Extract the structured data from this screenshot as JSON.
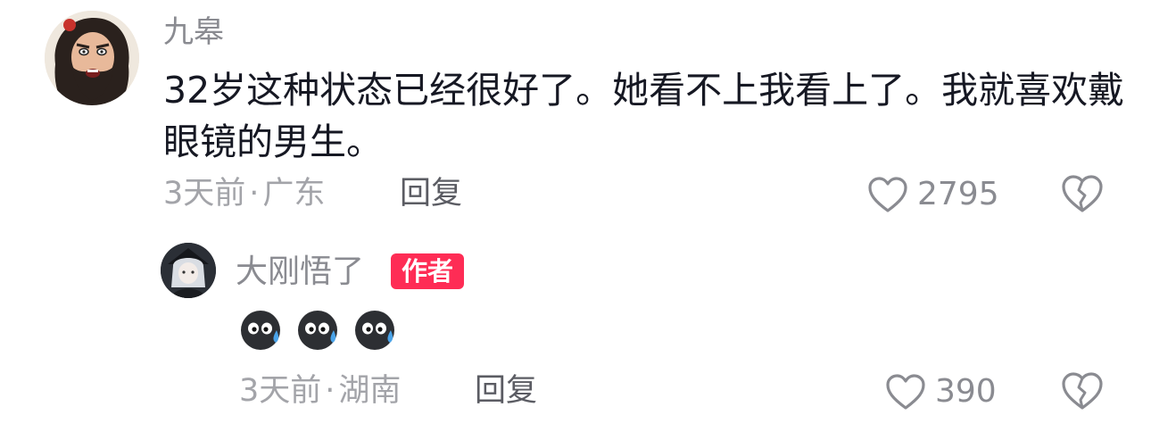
{
  "comment": {
    "username": "九皋",
    "avatar_icon": "bearded-man-avatar",
    "text": "32岁这种状态已经很好了。她看不上我看上了。我就喜欢戴眼镜的男生。",
    "time": "3天前",
    "location": "广东",
    "separator": "·",
    "reply_label": "回复",
    "like_count": "2795",
    "like_icon": "heart-outline-icon",
    "dislike_icon": "broken-heart-icon"
  },
  "reply": {
    "username": "大刚悟了",
    "avatar_icon": "anime-character-avatar",
    "author_badge": "作者",
    "author_badge_color": "#fe2c55",
    "emojis": [
      "sweat-face-emoji",
      "sweat-face-emoji",
      "sweat-face-emoji"
    ],
    "time": "3天前",
    "location": "湖南",
    "separator": "·",
    "reply_label": "回复",
    "like_count": "390",
    "like_icon": "heart-outline-icon",
    "dislike_icon": "broken-heart-icon"
  }
}
